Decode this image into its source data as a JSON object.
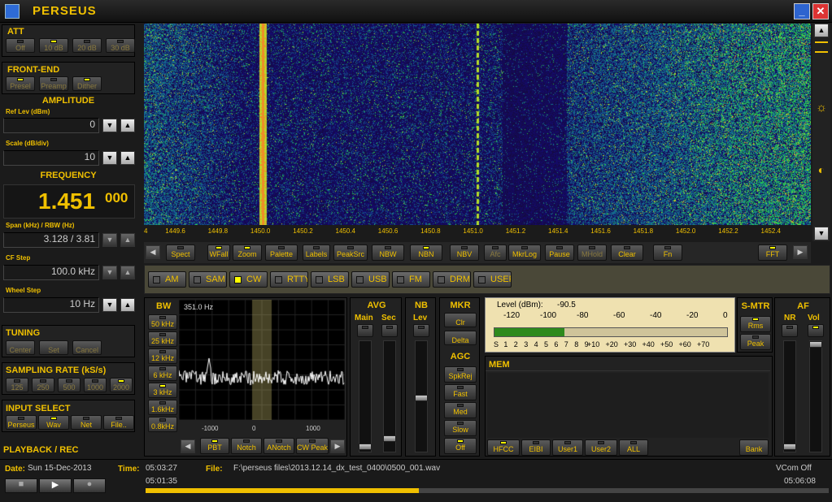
{
  "app": {
    "title": "PERSEUS"
  },
  "att": {
    "title": "ATT",
    "buttons": [
      {
        "label": "Off",
        "on": false
      },
      {
        "label": "10 dB",
        "on": true
      },
      {
        "label": "20 dB",
        "on": false
      },
      {
        "label": "30 dB",
        "on": false
      }
    ]
  },
  "frontend": {
    "title": "FRONT-END",
    "buttons": [
      {
        "label": "Presel",
        "on": true
      },
      {
        "label": "Preamp",
        "on": false
      },
      {
        "label": "Dither",
        "on": true
      }
    ]
  },
  "amplitude": {
    "title": "AMPLITUDE",
    "ref_label": "Ref Lev (dBm)",
    "ref_value": "0",
    "scale_label": "Scale (dB/div)",
    "scale_value": "10"
  },
  "frequency": {
    "title": "FREQUENCY",
    "main": "1.451",
    "fraction": "000",
    "span_label": "Span (kHz) / RBW (Hz)",
    "span_value": "3.128 / 3.81",
    "cf_label": "CF Step",
    "cf_value": "100.0 kHz",
    "wheel_label": "Wheel Step",
    "wheel_value": "10 Hz"
  },
  "tuning": {
    "title": "TUNING",
    "buttons": [
      "Center",
      "Set",
      "Cancel"
    ]
  },
  "sampling": {
    "title": "SAMPLING RATE (kS/s)",
    "buttons": [
      {
        "label": "125",
        "on": false
      },
      {
        "label": "250",
        "on": false
      },
      {
        "label": "500",
        "on": false
      },
      {
        "label": "1000",
        "on": false
      },
      {
        "label": "2000",
        "on": true
      }
    ]
  },
  "input": {
    "title": "INPUT SELECT",
    "buttons": [
      {
        "label": "Perseus",
        "on": false
      },
      {
        "label": "Wav",
        "on": true
      },
      {
        "label": "Net",
        "on": false
      },
      {
        "label": "File..",
        "on": false
      }
    ]
  },
  "playback": {
    "title": "PLAYBACK / REC"
  },
  "spectrum_ticks": [
    "4",
    "1449.6",
    "1449.8",
    "1450.0",
    "1450.2",
    "1450.4",
    "1450.6",
    "1450.8",
    "1451.0",
    "1451.2",
    "1451.4",
    "1451.6",
    "1451.8",
    "1452.0",
    "1452.2",
    "1452.4"
  ],
  "toolbar": [
    {
      "label": "Spect",
      "on": false
    },
    {
      "label": "WFall",
      "on": true
    },
    {
      "label": "Zoom",
      "on": true
    },
    {
      "label": "Palette",
      "on": false
    },
    {
      "label": "Labels",
      "on": false
    },
    {
      "label": "PeakSrc",
      "on": false
    },
    {
      "label": "NBW",
      "on": false
    },
    {
      "label": "NBN",
      "on": true
    },
    {
      "label": "NBV",
      "on": false
    },
    {
      "label": "Afc",
      "on": false
    },
    {
      "label": "MkrLog",
      "on": false
    },
    {
      "label": "Pause",
      "on": false
    },
    {
      "label": "MHold",
      "on": false
    },
    {
      "label": "Clear",
      "on": false
    },
    {
      "label": "Fn",
      "on": false
    },
    {
      "label": "FFT",
      "on": true
    }
  ],
  "modes": [
    {
      "label": "AM",
      "on": false
    },
    {
      "label": "SAM",
      "on": false
    },
    {
      "label": "CW",
      "on": true
    },
    {
      "label": "RTTY",
      "on": false
    },
    {
      "label": "LSB",
      "on": false
    },
    {
      "label": "USB",
      "on": false
    },
    {
      "label": "FM",
      "on": false
    },
    {
      "label": "DRM",
      "on": false
    },
    {
      "label": "USER",
      "on": false
    }
  ],
  "bw": {
    "title": "BW",
    "buttons": [
      {
        "label": "50 kHz",
        "on": false
      },
      {
        "label": "25 kHz",
        "on": false
      },
      {
        "label": "12 kHz",
        "on": false
      },
      {
        "label": "6 kHz",
        "on": false
      },
      {
        "label": "3 kHz",
        "on": true
      },
      {
        "label": "1.6kHz",
        "on": false
      },
      {
        "label": "0.8kHz",
        "on": false
      }
    ],
    "display": "351.0 Hz",
    "ticks": [
      "-1000",
      "0",
      "1000"
    ]
  },
  "filter_buttons": [
    {
      "label": "PBT",
      "on": true
    },
    {
      "label": "Notch",
      "on": false
    },
    {
      "label": "ANotch",
      "on": false
    },
    {
      "label": "CW Peak",
      "on": false
    }
  ],
  "avg": {
    "title": "AVG",
    "main": "Main",
    "sec": "Sec"
  },
  "nb": {
    "title": "NB",
    "lev": "Lev"
  },
  "mkr": {
    "title": "MKR",
    "buttons": [
      "Clr",
      "Delta"
    ]
  },
  "agc": {
    "title": "AGC",
    "buttons": [
      {
        "label": "SpkRej",
        "on": false
      },
      {
        "label": "Fast",
        "on": false
      },
      {
        "label": "Med",
        "on": false
      },
      {
        "label": "Slow",
        "on": false
      },
      {
        "label": "Off",
        "on": true
      }
    ]
  },
  "smeter": {
    "level_label": "Level (dBm):",
    "level_value": "-90.5",
    "dbm_ticks": [
      "-120",
      "-100",
      "-80",
      "-60",
      "-40",
      "-20",
      "0"
    ],
    "s_ticks": [
      "S",
      "1",
      "2",
      "3",
      "4",
      "5",
      "6",
      "7",
      "8",
      "9",
      "+10",
      "+20",
      "+30",
      "+40",
      "+50",
      "+60",
      "+70"
    ],
    "fill_fraction": 0.3
  },
  "smtr": {
    "title": "S-MTR",
    "buttons": [
      {
        "label": "Rms",
        "on": true
      },
      {
        "label": "Peak",
        "on": false
      }
    ]
  },
  "af": {
    "title": "AF",
    "nr": "NR",
    "vol": "Vol"
  },
  "mem": {
    "title": "MEM",
    "buttons": [
      {
        "label": "HFCC",
        "on": true
      },
      {
        "label": "EIBI",
        "on": false
      },
      {
        "label": "User1",
        "on": false
      },
      {
        "label": "User2",
        "on": false
      },
      {
        "label": "ALL",
        "on": false
      }
    ],
    "bank": "Bank"
  },
  "status": {
    "date_label": "Date:",
    "date_value": "Sun 15-Dec-2013",
    "time_label": "Time:",
    "time_value": "05:03:27",
    "file_label": "File:",
    "file_value": "F:\\perseus files\\2013.12.14_dx_test_0400\\0500_001.wav",
    "vcom": "VCom Off",
    "pos_start": "05:01:35",
    "pos_end": "05:06:08",
    "progress": 0.4
  }
}
